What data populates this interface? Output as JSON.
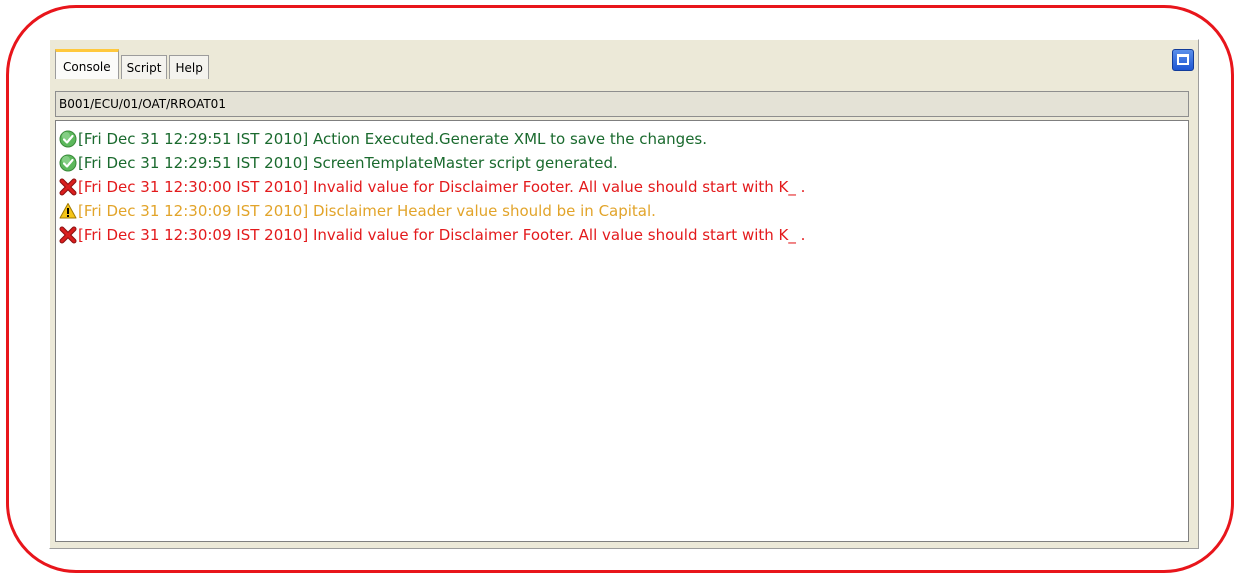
{
  "tabs": [
    {
      "label": "Console",
      "active": true
    },
    {
      "label": "Script",
      "active": false
    },
    {
      "label": "Help",
      "active": false
    }
  ],
  "path": "B001/ECU/01/OAT/RROAT01",
  "messages": [
    {
      "status": "success",
      "icon": "check-circle-icon",
      "text": "[Fri Dec 31 12:29:51 IST 2010] Action Executed.Generate XML to save the changes."
    },
    {
      "status": "success",
      "icon": "check-circle-icon",
      "text": "[Fri Dec 31 12:29:51 IST 2010] ScreenTemplateMaster script generated."
    },
    {
      "status": "error",
      "icon": "error-x-icon",
      "text": "[Fri Dec 31 12:30:00 IST 2010] Invalid value for Disclaimer Footer. All value should start with K_ ."
    },
    {
      "status": "warning",
      "icon": "warning-triangle-icon",
      "text": "[Fri Dec 31 12:30:09 IST 2010] Disclaimer Header value should be in Capital."
    },
    {
      "status": "error",
      "icon": "error-x-icon",
      "text": "[Fri Dec 31 12:30:09 IST 2010] Invalid value for Disclaimer Footer. All value should start with K_ ."
    }
  ],
  "colors": {
    "success": "#1a6a2e",
    "error": "#e31a1c",
    "warning": "#e2a42a",
    "highlight_frame": "#e8151b"
  }
}
